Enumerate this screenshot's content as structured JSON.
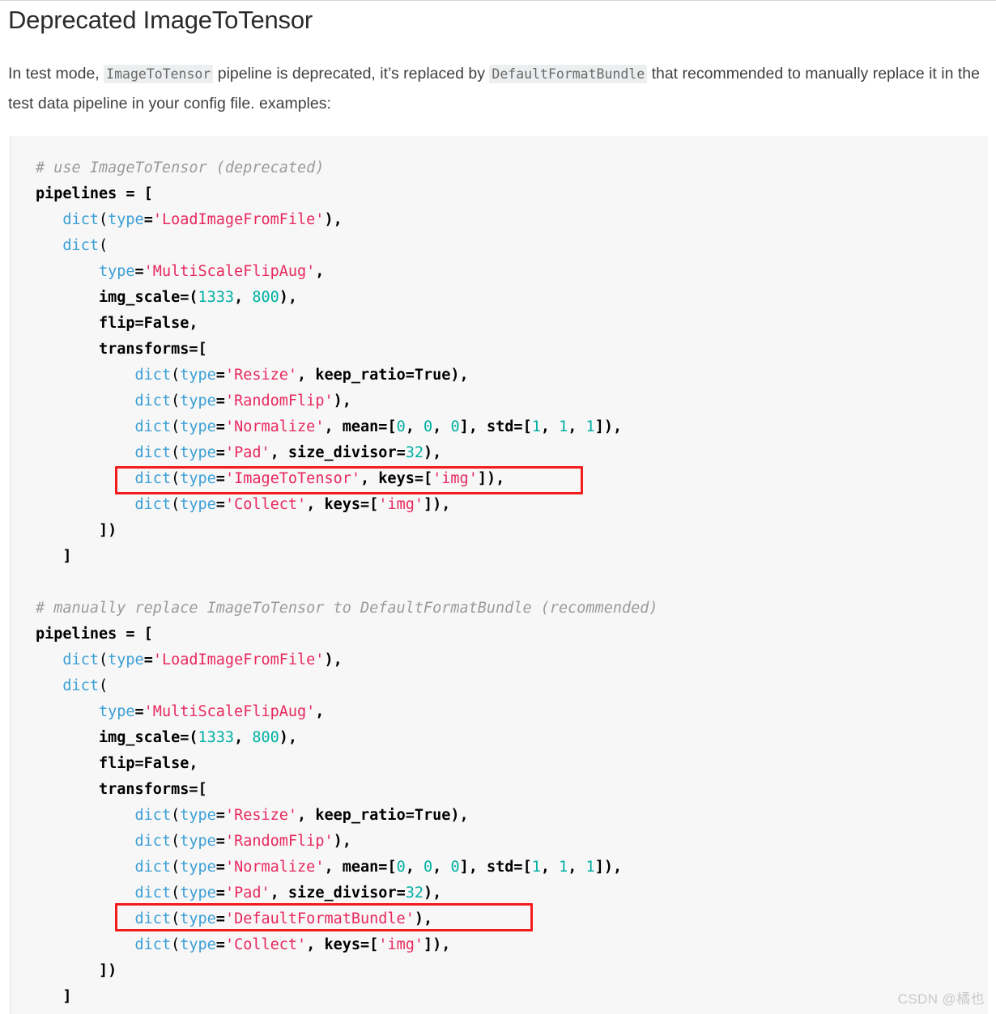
{
  "page": {
    "title": "Deprecated ImageToTensor",
    "watermark": "CSDN @橘也"
  },
  "intro": {
    "seg1": "In test mode,",
    "code1": "ImageToTensor",
    "seg2": "pipeline is deprecated, it’s replaced by",
    "code2": "DefaultFormatBundle",
    "seg3": "that recommended to manually replace it in the test data pipeline in your config file. examples:"
  },
  "colors": {
    "highlight_box": "#f21c1c",
    "code_background": "#f7f7f7",
    "function": "#3b9fd6",
    "string": "#e8285f",
    "number": "#00b0a3",
    "comment": "#9b9b9b",
    "inline_code_background": "#eceef0"
  },
  "code": {
    "block1": {
      "comment": "# use ImageToTensor (deprecated)",
      "assignment": "pipelines = [",
      "load_image": "dict(type='LoadImageFromFile'),",
      "dict_open": "dict(",
      "type_line": "type='MultiScaleFlipAug',",
      "img_scale": "img_scale=(1333, 800),",
      "flip": "flip=False,",
      "transforms_open": "transforms=[",
      "resize": "dict(type='Resize', keep_ratio=True),",
      "randomflip": "dict(type='RandomFlip'),",
      "normalize": "dict(type='Normalize', mean=[0, 0, 0], std=[1, 1, 1]),",
      "pad": "dict(type='Pad', size_divisor=32),",
      "highlighted": "dict(type='ImageToTensor', keys=['img']),",
      "collect": "dict(type='Collect', keys=['img']),",
      "close_inner": "])",
      "close_outer": "]"
    },
    "block2": {
      "comment": "# manually replace ImageToTensor to DefaultFormatBundle (recommended)",
      "assignment": "pipelines = [",
      "load_image": "dict(type='LoadImageFromFile'),",
      "dict_open": "dict(",
      "type_line": "type='MultiScaleFlipAug',",
      "img_scale": "img_scale=(1333, 800),",
      "flip": "flip=False,",
      "transforms_open": "transforms=[",
      "resize": "dict(type='Resize', keep_ratio=True),",
      "randomflip": "dict(type='RandomFlip'),",
      "normalize": "dict(type='Normalize', mean=[0, 0, 0], std=[1, 1, 1]),",
      "pad": "dict(type='Pad', size_divisor=32),",
      "highlighted": "dict(type='DefaultFormatBundle'),",
      "collect": "dict(type='Collect', keys=['img']),",
      "close_inner": "])",
      "close_outer": "]"
    }
  }
}
